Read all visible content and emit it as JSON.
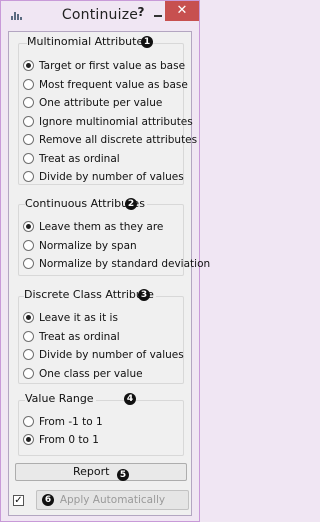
{
  "window": {
    "title": "Continuize",
    "help_label": "?",
    "close_label": "✕"
  },
  "groups": [
    {
      "id": "multinomial",
      "title": "Multinomial Attributes",
      "badge": "1",
      "selected_index": 0,
      "options": [
        "Target or first value as base",
        "Most frequent value as base",
        "One attribute per value",
        "Ignore multinomial attributes",
        "Remove all discrete attributes",
        "Treat as ordinal",
        "Divide by number of values"
      ]
    },
    {
      "id": "continuous",
      "title": "Continuous Attributes",
      "badge": "2",
      "selected_index": 0,
      "options": [
        "Leave them as they are",
        "Normalize by span",
        "Normalize by standard deviation"
      ]
    },
    {
      "id": "discrete-class",
      "title": "Discrete Class Attribute",
      "badge": "3",
      "selected_index": 0,
      "options": [
        "Leave it as it is",
        "Treat as ordinal",
        "Divide by number of values",
        "One class per value"
      ]
    },
    {
      "id": "value-range",
      "title": "Value Range",
      "badge": "4",
      "selected_index": 1,
      "options": [
        "From -1 to 1",
        "From 0 to 1"
      ]
    }
  ],
  "footer": {
    "report_label": "Report",
    "report_badge": "5",
    "apply_label": "Apply Automatically",
    "apply_badge": "6",
    "apply_checked": true,
    "check_mark": "✓"
  }
}
